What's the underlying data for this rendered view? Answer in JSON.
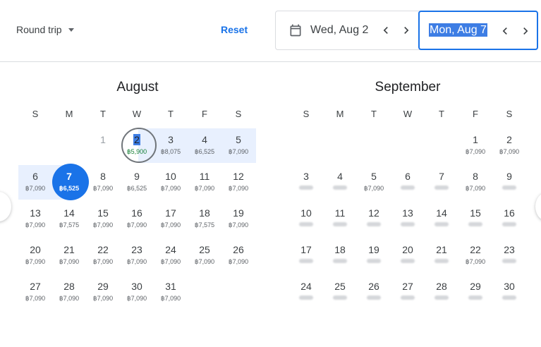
{
  "header": {
    "trip_type": "Round trip",
    "reset_label": "Reset",
    "departure": "Wed, Aug 2",
    "return": "Mon, Aug 7"
  },
  "icons": {
    "calendar": "calendar-icon",
    "prev": "chevron-left-icon",
    "next": "chevron-right-icon"
  },
  "colors": {
    "accent": "#1a73e8",
    "range": "#e8f0fe",
    "low_price": "#188038"
  },
  "weekdays": [
    "S",
    "M",
    "T",
    "W",
    "T",
    "F",
    "S"
  ],
  "months": [
    {
      "name": "August",
      "weeks": [
        [
          null,
          null,
          {
            "d": "1",
            "p": "",
            "past": true
          },
          {
            "d": "2",
            "p": "฿5,900",
            "low": true,
            "start": true
          },
          {
            "d": "3",
            "p": "฿8,075"
          },
          {
            "d": "4",
            "p": "฿6,525"
          },
          {
            "d": "5",
            "p": "฿7,090"
          }
        ],
        [
          {
            "d": "6",
            "p": "฿7,090"
          },
          {
            "d": "7",
            "p": "฿6,525",
            "end": true
          },
          {
            "d": "8",
            "p": "฿7,090"
          },
          {
            "d": "9",
            "p": "฿6,525"
          },
          {
            "d": "10",
            "p": "฿7,090"
          },
          {
            "d": "11",
            "p": "฿7,090"
          },
          {
            "d": "12",
            "p": "฿7,090"
          }
        ],
        [
          {
            "d": "13",
            "p": "฿7,090"
          },
          {
            "d": "14",
            "p": "฿7,575"
          },
          {
            "d": "15",
            "p": "฿7,090"
          },
          {
            "d": "16",
            "p": "฿7,090"
          },
          {
            "d": "17",
            "p": "฿7,090"
          },
          {
            "d": "18",
            "p": "฿7,575"
          },
          {
            "d": "19",
            "p": "฿7,090"
          }
        ],
        [
          {
            "d": "20",
            "p": "฿7,090"
          },
          {
            "d": "21",
            "p": "฿7,090"
          },
          {
            "d": "22",
            "p": "฿7,090"
          },
          {
            "d": "23",
            "p": "฿7,090"
          },
          {
            "d": "24",
            "p": "฿7,090"
          },
          {
            "d": "25",
            "p": "฿7,090"
          },
          {
            "d": "26",
            "p": "฿7,090"
          }
        ],
        [
          {
            "d": "27",
            "p": "฿7,090"
          },
          {
            "d": "28",
            "p": "฿7,090"
          },
          {
            "d": "29",
            "p": "฿7,090"
          },
          {
            "d": "30",
            "p": "฿7,090"
          },
          {
            "d": "31",
            "p": "฿7,090"
          },
          null,
          null
        ]
      ]
    },
    {
      "name": "September",
      "weeks": [
        [
          null,
          null,
          null,
          null,
          null,
          {
            "d": "1",
            "p": "฿7,090"
          },
          {
            "d": "2",
            "p": "฿7,090"
          }
        ],
        [
          {
            "d": "3",
            "blur": true
          },
          {
            "d": "4",
            "blur": true
          },
          {
            "d": "5",
            "p": "฿7,090"
          },
          {
            "d": "6",
            "blur": true
          },
          {
            "d": "7",
            "blur": true
          },
          {
            "d": "8",
            "p": "฿7,090"
          },
          {
            "d": "9",
            "blur": true
          }
        ],
        [
          {
            "d": "10",
            "blur": true
          },
          {
            "d": "11",
            "blur": true
          },
          {
            "d": "12",
            "blur": true
          },
          {
            "d": "13",
            "blur": true
          },
          {
            "d": "14",
            "blur": true
          },
          {
            "d": "15",
            "blur": true
          },
          {
            "d": "16",
            "blur": true
          }
        ],
        [
          {
            "d": "17",
            "blur": true
          },
          {
            "d": "18",
            "blur": true
          },
          {
            "d": "19",
            "blur": true
          },
          {
            "d": "20",
            "blur": true
          },
          {
            "d": "21",
            "blur": true
          },
          {
            "d": "22",
            "p": "฿7,090"
          },
          {
            "d": "23",
            "blur": true
          }
        ],
        [
          {
            "d": "24",
            "blur": true
          },
          {
            "d": "25",
            "blur": true
          },
          {
            "d": "26",
            "blur": true
          },
          {
            "d": "27",
            "blur": true
          },
          {
            "d": "28",
            "blur": true
          },
          {
            "d": "29",
            "blur": true
          },
          {
            "d": "30",
            "blur": true
          }
        ]
      ]
    }
  ]
}
